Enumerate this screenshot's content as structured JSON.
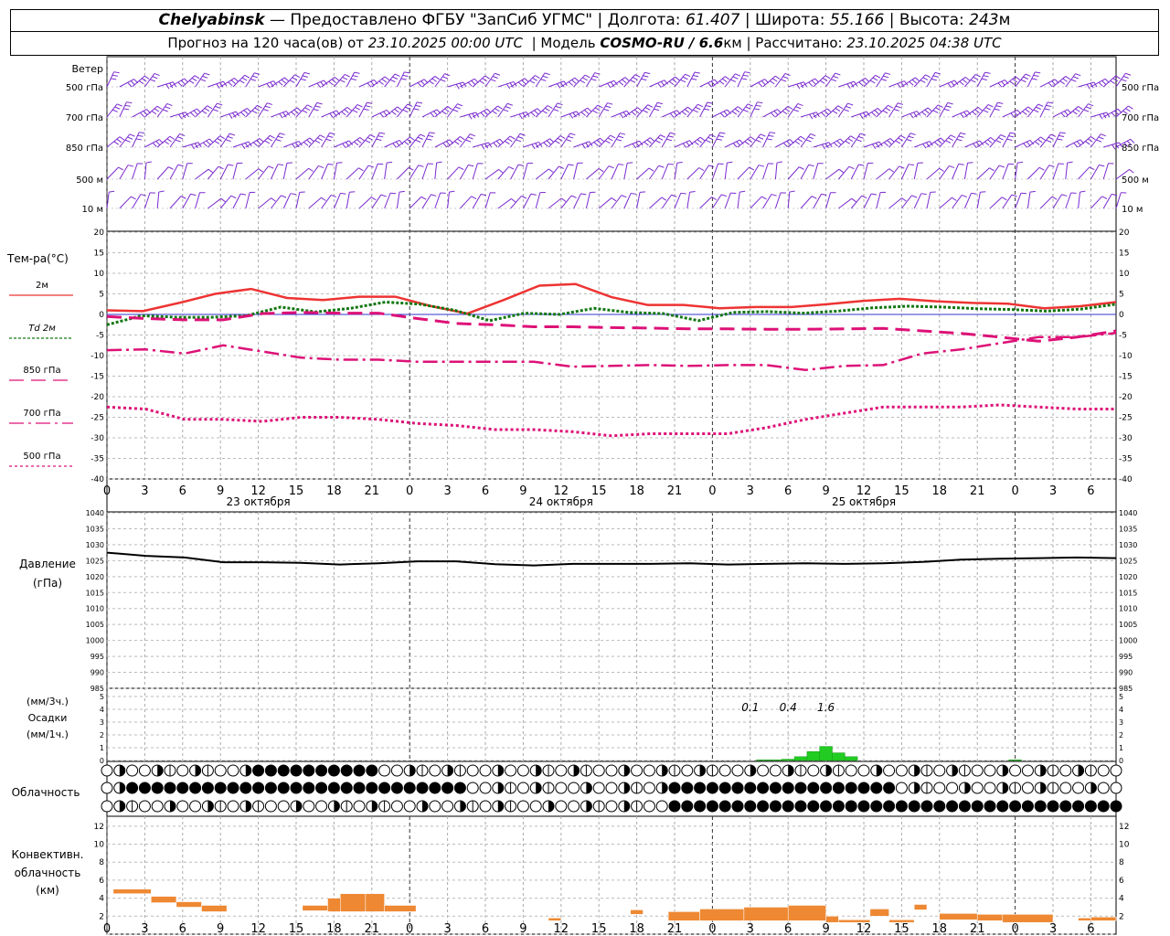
{
  "header": {
    "line1": {
      "city": "Chelyabinsk",
      "sep": " — ",
      "provider": "Предоставлено ФГБУ \"ЗапСиб УГМС\"",
      "lon_label": "Долгота:",
      "lon": "61.407",
      "lat_label": "Широта:",
      "lat": "55.166",
      "alt_label": "Высота:",
      "alt": "243",
      "alt_unit": "м"
    },
    "line2": {
      "prefix": "Прогноз на 120 часа(ов) от",
      "init": "23.10.2025 00:00 UTC",
      "model_label": "Модель",
      "model": "COSMO-RU / 6.6",
      "model_unit": "км",
      "calc_label": "Рассчитано:",
      "calc": "23.10.2025 04:38 UTC"
    }
  },
  "colors": {
    "t2m": "#ee3333",
    "td2m": "#117711",
    "t850": "#dd1177",
    "t700": "#dd1177",
    "t500": "#dd1177",
    "wind": "#7a2ad0",
    "pressure": "#000000",
    "precip": "#22cc22",
    "convective": "#ee8833",
    "grid": "#999999"
  },
  "chart_data": [
    {
      "type": "wind_barbs",
      "panel_label": "Ветер",
      "levels": [
        "500 гПа",
        "700 гПа",
        "850 гПа",
        "500 м",
        "10 м"
      ]
    },
    {
      "type": "line",
      "ylabel": "Тем-ра(°C)",
      "ylim": [
        -40,
        20
      ],
      "yticks": [
        20,
        15,
        10,
        5,
        0,
        -5,
        -10,
        -15,
        -20,
        -25,
        -30,
        -35,
        -40
      ],
      "x_hours": [
        0,
        3,
        6,
        9,
        12,
        15,
        18,
        21,
        24,
        27,
        30,
        33,
        36,
        39,
        42,
        45,
        48,
        51,
        54,
        57,
        60,
        63,
        66,
        69,
        72,
        75,
        78
      ],
      "series": [
        {
          "name": "2м",
          "legend": "2м",
          "values": [
            1,
            0.8,
            2.8,
            5,
            6.2,
            4,
            3.5,
            4.3,
            4.3,
            2,
            0.2,
            3.5,
            7,
            7.4,
            4.2,
            2.3,
            2.3,
            1.5,
            1.8,
            1.8,
            2.5,
            3.3,
            3.8,
            3.2,
            2.8,
            2.6,
            1.5,
            2,
            3
          ]
        },
        {
          "name": "Td 2м",
          "legend": "Td  2м",
          "values": [
            -2.5,
            -0.3,
            -0.7,
            -0.7,
            -0.3,
            1.8,
            0.6,
            1.5,
            3,
            2.5,
            1,
            -1.5,
            0.3,
            0,
            1.5,
            0.5,
            0.2,
            -1.5,
            0.5,
            0.7,
            0.3,
            0.8,
            1.6,
            2,
            1.8,
            1.4,
            1.2,
            0.8,
            1.3,
            2.5
          ]
        },
        {
          "name": "850 гПа",
          "legend": "850 гПа",
          "values": [
            -0.5,
            -1,
            -1.3,
            -1.3,
            0.2,
            0.5,
            0.3,
            0.3,
            -1,
            -2.2,
            -2.5,
            -3,
            -3,
            -3.2,
            -3.3,
            -3.5,
            -3.5,
            -3.6,
            -3.6,
            -3.5,
            -3.4,
            -4,
            -4.6,
            -5.5,
            -6.5,
            -5.5,
            -4
          ]
        },
        {
          "name": "700 гПа",
          "legend": "700 гПа",
          "values": [
            -8.7,
            -8.5,
            -9.5,
            -7.5,
            -9,
            -10.5,
            -11,
            -11,
            -11.5,
            -11.5,
            -11.5,
            -11.5,
            -12.7,
            -12.5,
            -12.3,
            -12.5,
            -12.3,
            -12.3,
            -13.5,
            -12.5,
            -12.3,
            -9.5,
            -8.5,
            -7,
            -5.5,
            -5.5,
            -4.5
          ]
        },
        {
          "name": "500 гПа",
          "legend": "500 гПа",
          "values": [
            -22.5,
            -23,
            -25.5,
            -25.5,
            -26,
            -25,
            -25,
            -25.5,
            -26.5,
            -27,
            -28,
            -28,
            -28.5,
            -29.5,
            -29,
            -29,
            -29,
            -27.5,
            -25.5,
            -24,
            -22.5,
            -22.5,
            -22.5,
            -22,
            -22.5,
            -23,
            -23
          ]
        }
      ],
      "xlabel_ticks": [
        "0",
        "3",
        "6",
        "9",
        "12",
        "15",
        "18",
        "21",
        "0",
        "3",
        "6",
        "9",
        "12",
        "15",
        "18",
        "21",
        "0",
        "3",
        "6",
        "9",
        "12",
        "15",
        "18",
        "21",
        "0",
        "3",
        "6"
      ],
      "dates": [
        "23 октября",
        "24 октября",
        "25 октября"
      ]
    },
    {
      "type": "line",
      "ylabel": "Давление",
      "ylabel2": "(гПа)",
      "ylim": [
        985,
        1040
      ],
      "yticks": [
        1040,
        1035,
        1030,
        1025,
        1020,
        1015,
        1010,
        1005,
        1000,
        995,
        990,
        985
      ],
      "values": [
        1027.5,
        1026.5,
        1026,
        1024.5,
        1024.5,
        1024.3,
        1023.8,
        1024.2,
        1024.8,
        1024.8,
        1023.9,
        1023.5,
        1024,
        1024,
        1024,
        1024.2,
        1023.8,
        1024,
        1024.2,
        1024,
        1024.2,
        1024.6,
        1025.3,
        1025.6,
        1025.8,
        1026,
        1025.8
      ]
    },
    {
      "type": "bar",
      "ylabel": "Осадки",
      "unit_top": "(мм/3ч.)",
      "unit_bot": "(мм/1ч.)",
      "ylim": [
        0,
        5
      ],
      "yticks": [
        5,
        4,
        3,
        2,
        1,
        0
      ],
      "totals": [
        "0.1",
        "0.4",
        "1.6"
      ],
      "hourly": [
        {
          "h": 52,
          "v": 0.05
        },
        {
          "h": 53,
          "v": 0.05
        },
        {
          "h": 54,
          "v": 0.1
        },
        {
          "h": 55,
          "v": 0.3
        },
        {
          "h": 56,
          "v": 0.7
        },
        {
          "h": 57,
          "v": 1.1
        },
        {
          "h": 58,
          "v": 0.6
        },
        {
          "h": 59,
          "v": 0.3
        },
        {
          "h": 72,
          "v": 0.05
        }
      ]
    },
    {
      "type": "table",
      "ylabel": "Облачность",
      "rows": 3
    },
    {
      "type": "bar",
      "ylabel": "Конвективн.",
      "ylabel2": "облачность",
      "ylabel3": "(км)",
      "ylim": [
        0,
        13
      ],
      "yticks": [
        12,
        10,
        8,
        6,
        4,
        2,
        0
      ],
      "segments": [
        {
          "x0": 0.5,
          "x1": 3.5,
          "lo": 4.5,
          "hi": 5
        },
        {
          "x0": 3.5,
          "x1": 5.5,
          "lo": 3.5,
          "hi": 4.2
        },
        {
          "x0": 5.5,
          "x1": 7.5,
          "lo": 3,
          "hi": 3.6
        },
        {
          "x0": 7.5,
          "x1": 9.5,
          "lo": 2.5,
          "hi": 3.2
        },
        {
          "x0": 15.5,
          "x1": 17.5,
          "lo": 2.6,
          "hi": 3.2
        },
        {
          "x0": 17.5,
          "x1": 18.5,
          "lo": 2.5,
          "hi": 4
        },
        {
          "x0": 18.5,
          "x1": 20.5,
          "lo": 2.5,
          "hi": 4.5
        },
        {
          "x0": 20.5,
          "x1": 22,
          "lo": 2.5,
          "hi": 4.5
        },
        {
          "x0": 22,
          "x1": 24.5,
          "lo": 2.5,
          "hi": 3.2
        },
        {
          "x0": 35,
          "x1": 36,
          "lo": 1.5,
          "hi": 1.8
        },
        {
          "x0": 41.5,
          "x1": 42.5,
          "lo": 2.2,
          "hi": 2.7
        },
        {
          "x0": 44.5,
          "x1": 47,
          "lo": 1.5,
          "hi": 2.5
        },
        {
          "x0": 47,
          "x1": 50.5,
          "lo": 1.5,
          "hi": 2.8
        },
        {
          "x0": 50.5,
          "x1": 54,
          "lo": 1.5,
          "hi": 3
        },
        {
          "x0": 54,
          "x1": 57,
          "lo": 1.5,
          "hi": 3.2
        },
        {
          "x0": 57,
          "x1": 58,
          "lo": 1.3,
          "hi": 2
        },
        {
          "x0": 58,
          "x1": 60.5,
          "lo": 1.3,
          "hi": 1.6
        },
        {
          "x0": 60.5,
          "x1": 62,
          "lo": 2,
          "hi": 2.8
        },
        {
          "x0": 62,
          "x1": 64,
          "lo": 1.3,
          "hi": 1.6
        },
        {
          "x0": 64,
          "x1": 65,
          "lo": 2.7,
          "hi": 3.3
        },
        {
          "x0": 66,
          "x1": 69,
          "lo": 1.6,
          "hi": 2.3
        },
        {
          "x0": 69,
          "x1": 71,
          "lo": 1.5,
          "hi": 2.2
        },
        {
          "x0": 71,
          "x1": 75,
          "lo": 1.3,
          "hi": 2.2
        },
        {
          "x0": 77,
          "x1": 78,
          "lo": 1.5,
          "hi": 1.8
        },
        {
          "x0": 78,
          "x1": 80,
          "lo": 1.5,
          "hi": 1.9
        }
      ]
    }
  ]
}
